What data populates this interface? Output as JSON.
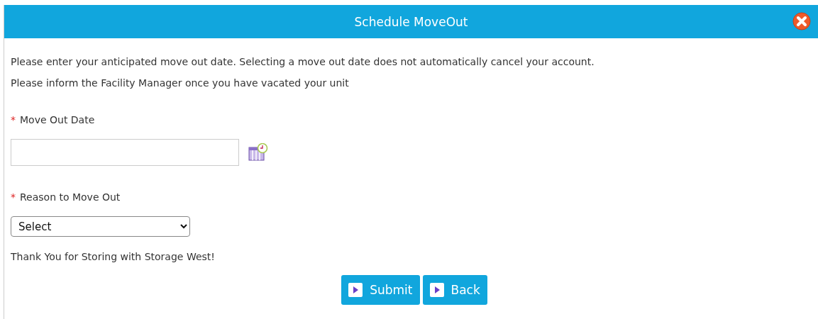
{
  "dialog": {
    "title": "Schedule MoveOut"
  },
  "intro": [
    "Please enter your anticipated move out date. Selecting a move out date does not automatically cancel your account.",
    "Please inform the Facility Manager once you have vacated your unit"
  ],
  "fields": [
    {
      "kind": "date",
      "label": "Move Out Date",
      "required_mark": "*"
    },
    {
      "kind": "select",
      "label": "Reason to Move Out",
      "required_mark": "*",
      "value": "Select"
    }
  ],
  "note": "Thank You for Storing with Storage West!",
  "buttons": [
    "Submit",
    "Back"
  ]
}
